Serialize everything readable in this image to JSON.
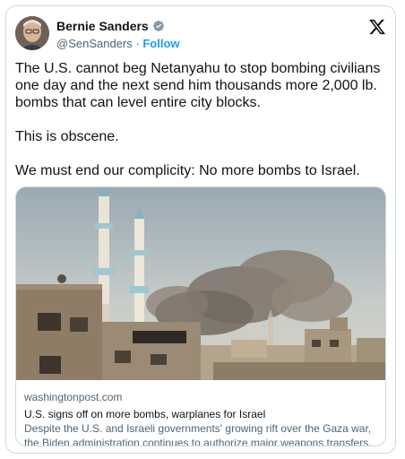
{
  "author": {
    "name": "Bernie Sanders",
    "handle": "@SenSanders",
    "separator": "·",
    "follow_label": "Follow"
  },
  "tweet": {
    "paragraphs": [
      "The U.S. cannot beg Netanyahu to stop bombing civilians one day and the next send him thousands more 2,000 lb. bombs that can level entire city blocks.",
      "This is obscene.",
      "We must end our complicity: No more bombs to Israel."
    ]
  },
  "link_card": {
    "domain": "washingtonpost.com",
    "headline": "U.S. signs off on more bombs, warplanes for Israel",
    "description": "Despite the U.S. and Israeli governments' growing rift over the Gaza war, the Biden administration continues to authorize major weapons transfers."
  },
  "icons": {
    "verified": "verified-badge-icon",
    "platform": "x-logo-icon"
  },
  "colors": {
    "accent": "#1d9bf0",
    "text_primary": "#0f1419",
    "text_secondary": "#536471",
    "border": "#cfd9de"
  }
}
